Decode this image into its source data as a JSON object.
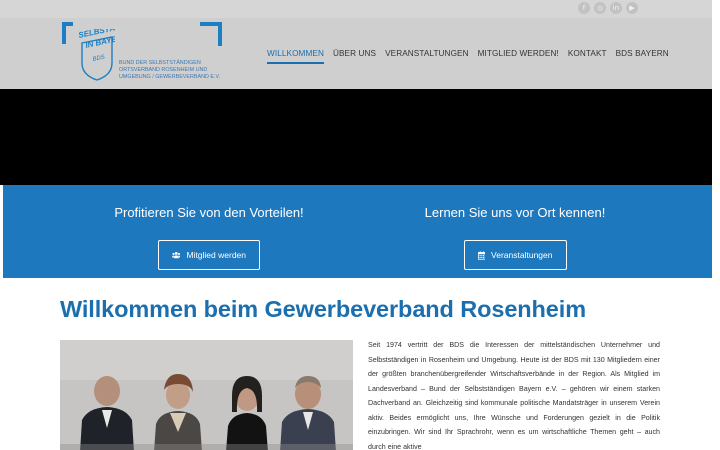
{
  "social": [
    {
      "icon": "facebook-icon",
      "glyph": "f"
    },
    {
      "icon": "instagram-icon",
      "glyph": "◎"
    },
    {
      "icon": "linkedin-icon",
      "glyph": "in"
    },
    {
      "icon": "youtube-icon",
      "glyph": "▶"
    }
  ],
  "logo": {
    "line1": "SELBSTÄNDIGE",
    "line2": "IN BAYERN",
    "badge": "BDS",
    "subtitle": "BUND DER SELBSTSTÄNDIGEN ORTSVERBAND ROSENHEIM UND UMGEBUNG / GEWERBEVERBAND e.V."
  },
  "nav": {
    "items": [
      {
        "label": "WILLKOMMEN",
        "active": true
      },
      {
        "label": "ÜBER UNS",
        "active": false
      },
      {
        "label": "VERANSTALTUNGEN",
        "active": false
      },
      {
        "label": "MITGLIED WERDEN!",
        "active": false
      },
      {
        "label": "KONTAKT",
        "active": false
      },
      {
        "label": "BDS BAYERN",
        "active": false
      }
    ]
  },
  "cta": {
    "left_heading": "Profitieren Sie von den Vorteilen!",
    "left_button": "Mitglied werden",
    "left_icon": "users-icon",
    "right_heading": "Lernen Sie uns vor Ort kennen!",
    "right_button": "Veranstaltungen",
    "right_icon": "calendar-icon"
  },
  "main": {
    "title": "Willkommen beim Gewerbeverband Rosenheim",
    "intro": "Seit 1974 vertritt der BDS die Interessen der mittelständischen Unternehmer und Selbstständigen in Rosenheim und Umgebung. Heute ist der BDS mit 130 Mitgliedern einer der größten branchenübergreifender Wirtschaftsverbände in der Region. Als Mitglied im Landesverband – Bund der Selbstständigen Bayern e.V. – gehören wir einem starken Dachverband an. Gleichzeitig sind kommunale politische Mandatsträger in unserem Verein aktiv. Beides ermöglicht uns, Ihre Wünsche und Forderungen gezielt in die Politik einzubringen. Wir sind Ihr Sprachrohr, wenn es um wirtschaftliche Themen geht – auch durch eine aktive"
  },
  "colors": {
    "brand_blue": "#1e78be",
    "title_blue": "#1c6fae",
    "header_gray": "#cfcfcf",
    "topbar_gray": "#d6d6d6"
  }
}
